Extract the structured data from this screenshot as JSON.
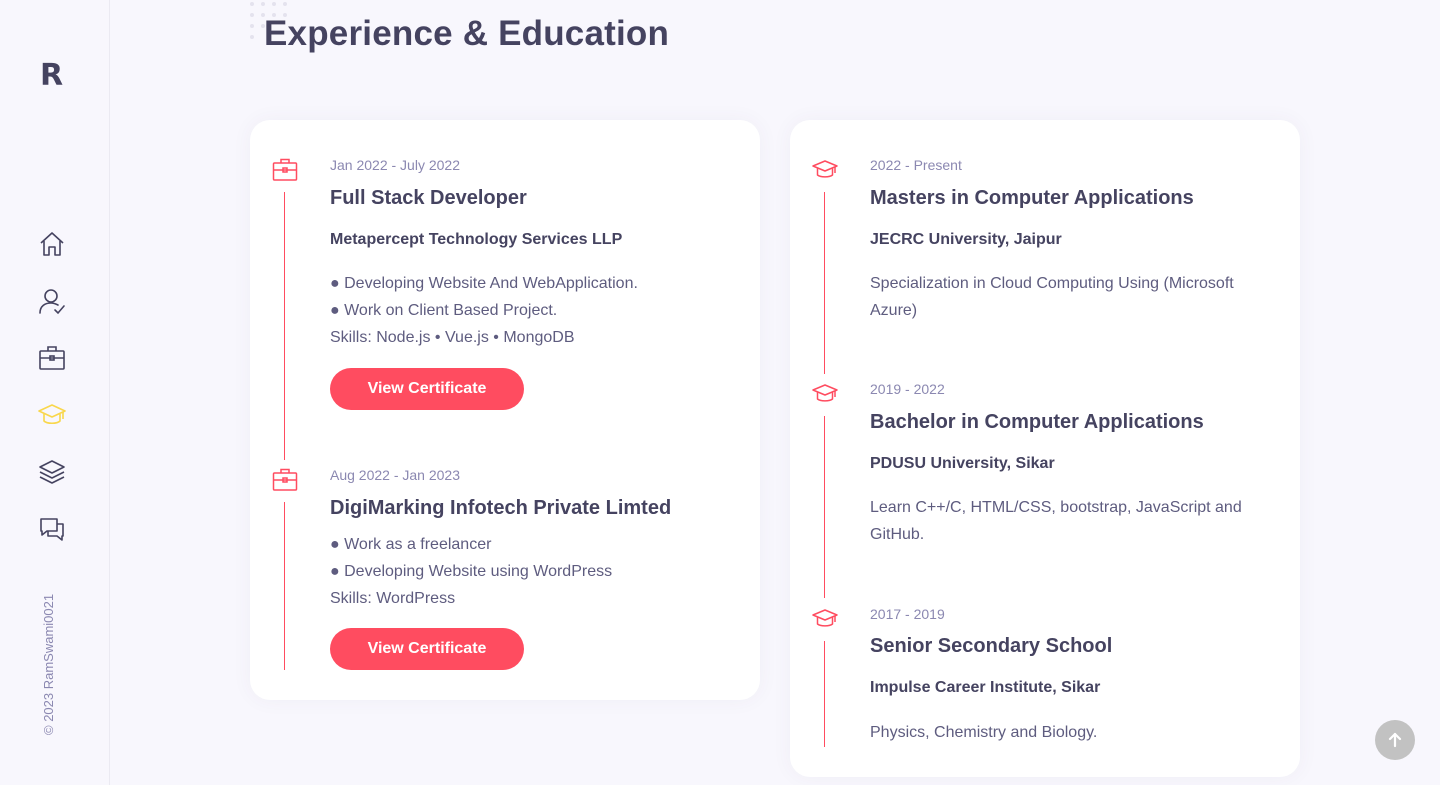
{
  "brand": {
    "logo": "R"
  },
  "sidebar": {
    "items": [
      {
        "name": "home",
        "icon": "home-icon"
      },
      {
        "name": "about",
        "icon": "user-check-icon"
      },
      {
        "name": "services",
        "icon": "briefcase-icon"
      },
      {
        "name": "experience",
        "icon": "graduation-cap-icon",
        "active": true
      },
      {
        "name": "works",
        "icon": "layers-icon"
      },
      {
        "name": "contact",
        "icon": "chat-bubbles-icon"
      }
    ],
    "copyright": "© 2023 RamSwami0021"
  },
  "colors": {
    "accent": "#ff4c60",
    "active": "#f9d74c",
    "text": "#454360",
    "muted": "#8b88b1"
  },
  "page": {
    "title": "Experience & Education"
  },
  "experience": [
    {
      "date": "Jan 2022 - July 2022",
      "title": "Full Stack Developer",
      "org": "Metapercept Technology Services LLP",
      "lines": [
        "● Developing Website And WebApplication.",
        "● Work on Client Based Project.",
        "Skills: Node.js • Vue.js • MongoDB"
      ],
      "button": "View Certificate"
    },
    {
      "date": "Aug 2022 - Jan 2023",
      "title": "DigiMarking Infotech Private Limted",
      "lines": [
        "● Work as a freelancer",
        "● Developing Website using WordPress",
        "Skills: WordPress"
      ],
      "button": "View Certificate"
    }
  ],
  "education": [
    {
      "date": "2022 - Present",
      "title": "Masters in Computer Applications",
      "org": "JECRC University, Jaipur",
      "text": "Specialization in Cloud Computing Using (Microsoft Azure)"
    },
    {
      "date": "2019 - 2022",
      "title": "Bachelor in Computer Applications",
      "org": "PDUSU University, Sikar",
      "text": "Learn C++/C, HTML/CSS, bootstrap, JavaScript and GitHub."
    },
    {
      "date": "2017 - 2019",
      "title": "Senior Secondary School",
      "org": "Impulse Career Institute, Sikar",
      "text": "Physics, Chemistry and Biology."
    }
  ]
}
